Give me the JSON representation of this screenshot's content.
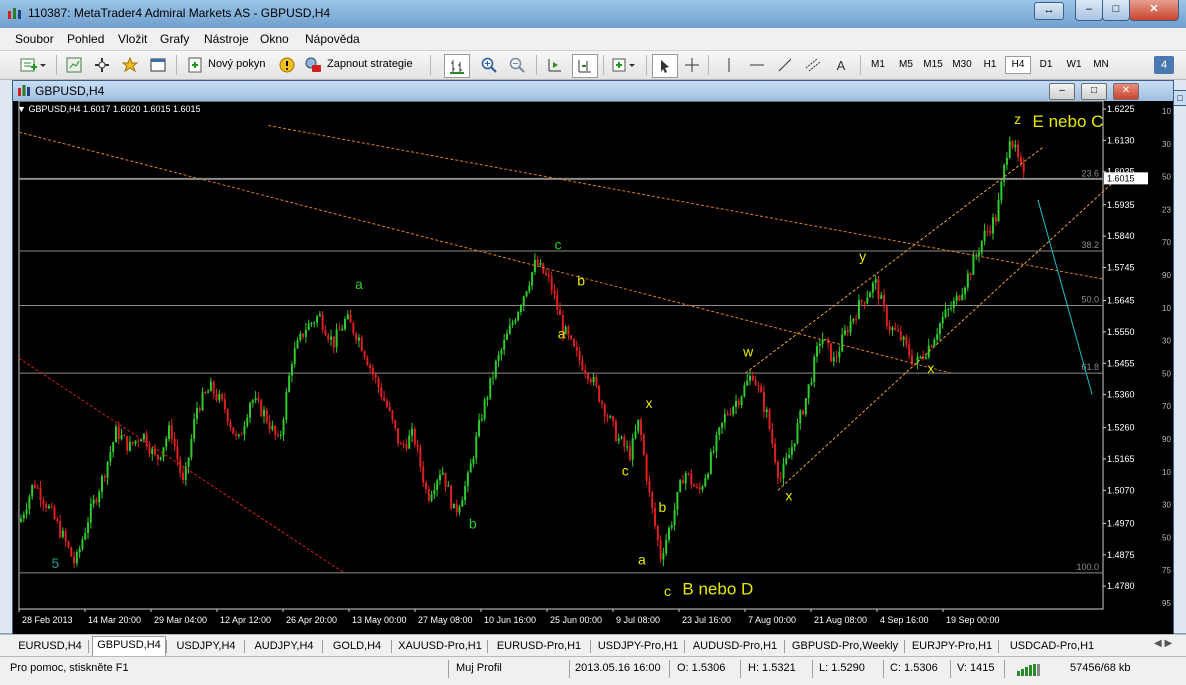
{
  "window": {
    "title": "110387: MetaTrader4 Admiral Markets AS - GBPUSD,H4"
  },
  "menu": [
    "Soubor",
    "Pohled",
    "Vložit",
    "Grafy",
    "Nástroje",
    "Okno",
    "Nápověda"
  ],
  "toolbar": {
    "new_order": "Nový pokyn",
    "auto_trading": "Zapnout strategie",
    "text_tool": "A",
    "timeframes": [
      "M1",
      "M5",
      "M15",
      "M30",
      "H1",
      "H4",
      "D1",
      "W1",
      "MN"
    ],
    "active_timeframe": "H4",
    "right_badge": "4"
  },
  "chart_window": {
    "title": "GBPUSD,H4",
    "header_info": "GBPUSD,H4  1.6017 1.6020 1.6015 1.6015"
  },
  "chart_data": {
    "type": "candlestick",
    "symbol": "GBPUSD",
    "timeframe": "H4",
    "ohlc_header": {
      "open": 1.6017,
      "high": 1.602,
      "low": 1.6015,
      "close": 1.6015
    },
    "current_price": "1.6015",
    "ylim": [
      1.4735,
      1.6225
    ],
    "y_ticks": [
      "1.6225",
      "1.6130",
      "1.6035",
      "1.5935",
      "1.5840",
      "1.5745",
      "1.5645",
      "1.5550",
      "1.5455",
      "1.5360",
      "1.5260",
      "1.5165",
      "1.5070",
      "1.4970",
      "1.4875",
      "1.4780"
    ],
    "x_ticks": [
      "28 Feb 2013",
      "14 Mar 20:00",
      "29 Mar 04:00",
      "12 Apr 12:00",
      "26 Apr 20:00",
      "13 May 00:00",
      "27 May 08:00",
      "10 Jun 16:00",
      "25 Jun 00:00",
      "9 Jul 08:00",
      "23 Jul 16:00",
      "7 Aug 00:00",
      "21 Aug 08:00",
      "4 Sep 16:00",
      "19 Sep 00:00"
    ],
    "fib_levels": [
      {
        "label": "23.6",
        "price": 1.6012
      },
      {
        "label": "38.2",
        "price": 1.5795
      },
      {
        "label": "50.0",
        "price": 1.563
      },
      {
        "label": "61.8",
        "price": 1.5425
      },
      {
        "label": "100.0",
        "price": 1.482
      }
    ],
    "path_points": [
      [
        0,
        1.4985
      ],
      [
        0.012,
        1.5095
      ],
      [
        0.025,
        1.502
      ],
      [
        0.038,
        1.4935
      ],
      [
        0.05,
        1.4845
      ],
      [
        0.062,
        1.4985
      ],
      [
        0.075,
        1.5105
      ],
      [
        0.088,
        1.525
      ],
      [
        0.1,
        1.52
      ],
      [
        0.112,
        1.5245
      ],
      [
        0.125,
        1.516
      ],
      [
        0.138,
        1.526
      ],
      [
        0.15,
        1.508
      ],
      [
        0.162,
        1.532
      ],
      [
        0.175,
        1.538
      ],
      [
        0.188,
        1.532
      ],
      [
        0.2,
        1.521
      ],
      [
        0.212,
        1.535
      ],
      [
        0.225,
        1.53
      ],
      [
        0.238,
        1.521
      ],
      [
        0.25,
        1.547
      ],
      [
        0.262,
        1.556
      ],
      [
        0.275,
        1.56
      ],
      [
        0.288,
        1.5515
      ],
      [
        0.3,
        1.559
      ],
      [
        0.312,
        1.553
      ],
      [
        0.325,
        1.542
      ],
      [
        0.338,
        1.532
      ],
      [
        0.35,
        1.52
      ],
      [
        0.362,
        1.524
      ],
      [
        0.375,
        1.505
      ],
      [
        0.388,
        1.514
      ],
      [
        0.4,
        1.5
      ],
      [
        0.412,
        1.51
      ],
      [
        0.425,
        1.53
      ],
      [
        0.438,
        1.545
      ],
      [
        0.45,
        1.555
      ],
      [
        0.462,
        1.565
      ],
      [
        0.475,
        1.576
      ],
      [
        0.488,
        1.57
      ],
      [
        0.5,
        1.556
      ],
      [
        0.512,
        1.548
      ],
      [
        0.525,
        1.542
      ],
      [
        0.538,
        1.532
      ],
      [
        0.55,
        1.523
      ],
      [
        0.562,
        1.518
      ],
      [
        0.57,
        1.528
      ],
      [
        0.58,
        1.505
      ],
      [
        0.59,
        1.487
      ],
      [
        0.6,
        1.4975
      ],
      [
        0.612,
        1.513
      ],
      [
        0.625,
        1.506
      ],
      [
        0.638,
        1.518
      ],
      [
        0.65,
        1.53
      ],
      [
        0.662,
        1.535
      ],
      [
        0.675,
        1.5425
      ],
      [
        0.688,
        1.53
      ],
      [
        0.7,
        1.51
      ],
      [
        0.71,
        1.519
      ],
      [
        0.725,
        1.536
      ],
      [
        0.738,
        1.554
      ],
      [
        0.75,
        1.546
      ],
      [
        0.762,
        1.556
      ],
      [
        0.775,
        1.564
      ],
      [
        0.788,
        1.57
      ],
      [
        0.8,
        1.557
      ],
      [
        0.812,
        1.553
      ],
      [
        0.825,
        1.545
      ],
      [
        0.838,
        1.551
      ],
      [
        0.85,
        1.559
      ],
      [
        0.862,
        1.564
      ],
      [
        0.875,
        1.573
      ],
      [
        0.888,
        1.584
      ],
      [
        0.9,
        1.59
      ],
      [
        0.912,
        1.615
      ],
      [
        0.925,
        1.6015
      ]
    ],
    "wave_labels": [
      {
        "text": "5",
        "x": 0.03,
        "price": 1.4835,
        "color": "#19a089"
      },
      {
        "text": "a",
        "x": 0.31,
        "price": 1.568,
        "color": "#2ecc2e"
      },
      {
        "text": "b",
        "x": 0.415,
        "price": 1.4955,
        "color": "#2ecc2e"
      },
      {
        "text": "c",
        "x": 0.494,
        "price": 1.58,
        "color": "#2ecc2e"
      },
      {
        "text": "b",
        "x": 0.515,
        "price": 1.569,
        "color": "#e8e800"
      },
      {
        "text": "a",
        "x": 0.497,
        "price": 1.553,
        "color": "#e8e800"
      },
      {
        "text": "x",
        "x": 0.578,
        "price": 1.532,
        "color": "#e8e800"
      },
      {
        "text": "c",
        "x": 0.556,
        "price": 1.5115,
        "color": "#e8e800"
      },
      {
        "text": "b",
        "x": 0.59,
        "price": 1.5005,
        "color": "#e8e800"
      },
      {
        "text": "a",
        "x": 0.571,
        "price": 1.4845,
        "color": "#e8e800"
      },
      {
        "text": "c",
        "x": 0.595,
        "price": 1.475,
        "color": "#e8e800"
      },
      {
        "text": "B nebo D",
        "x": 0.612,
        "price": 1.4755,
        "color": "#e8e800"
      },
      {
        "text": "w",
        "x": 0.668,
        "price": 1.5475,
        "color": "#e8e800"
      },
      {
        "text": "x",
        "x": 0.707,
        "price": 1.504,
        "color": "#e8e800"
      },
      {
        "text": "y",
        "x": 0.775,
        "price": 1.5765,
        "color": "#e8e800"
      },
      {
        "text": "x",
        "x": 0.838,
        "price": 1.5425,
        "color": "#e8e800"
      },
      {
        "text": "z",
        "x": 0.918,
        "price": 1.618,
        "color": "#e8e800"
      },
      {
        "text": "E nebo C",
        "x": 0.935,
        "price": 1.617,
        "color": "#e8e800"
      }
    ],
    "trendlines": [
      {
        "x1": 0.0,
        "p1": 1.6155,
        "x2": 0.86,
        "p2": 1.5425,
        "color": "#e07b1f",
        "dash": true
      },
      {
        "x1": 0.0,
        "p1": 1.547,
        "x2": 0.3,
        "p2": 1.482,
        "color": "#d02020",
        "dash": true
      },
      {
        "x1": 0.23,
        "p1": 1.6175,
        "x2": 1.0,
        "p2": 1.571,
        "color": "#e07b1f",
        "dash": true
      },
      {
        "x1": 0.67,
        "p1": 1.5425,
        "x2": 0.945,
        "p2": 1.611,
        "color": "#e8a030",
        "dash": true
      },
      {
        "x1": 0.7,
        "p1": 1.507,
        "x2": 1.02,
        "p2": 1.6035,
        "color": "#e8a030",
        "dash": true
      },
      {
        "x1": 0.94,
        "p1": 1.595,
        "x2": 0.99,
        "p2": 1.536,
        "color": "#20c0c0",
        "dash": false
      }
    ],
    "right_axis_fragments": [
      "10",
      "30",
      "50",
      "23",
      "70",
      "90",
      "10",
      "30",
      "50",
      "70",
      "90",
      "10",
      "30",
      "50",
      "75",
      "95"
    ],
    "grid": false,
    "colors": {
      "bull": "#2ecc2e",
      "bear": "#e02020",
      "background": "#000000",
      "axis_text": "#ffffff"
    }
  },
  "tabs": [
    "EURUSD,H4",
    "GBPUSD,H4",
    "USDJPY,H4",
    "AUDJPY,H4",
    "GOLD,H4",
    "XAUUSD-Pro,H1",
    "EURUSD-Pro,H1",
    "USDJPY-Pro,H1",
    "AUDUSD-Pro,H1",
    "GBPUSD-Pro,Weekly",
    "EURJPY-Pro,H1",
    "USDCAD-Pro,H1"
  ],
  "active_tab": "GBPUSD,H4",
  "status": {
    "help": "Pro pomoc, stiskněte F1",
    "profile": "Muj Profil",
    "datetime": "2013.05.16 16:00",
    "open": "O: 1.5306",
    "high": "H: 1.5321",
    "low": "L: 1.5290",
    "close": "C: 1.5306",
    "volume": "V: 1415",
    "traffic": "57456/68 kb"
  }
}
